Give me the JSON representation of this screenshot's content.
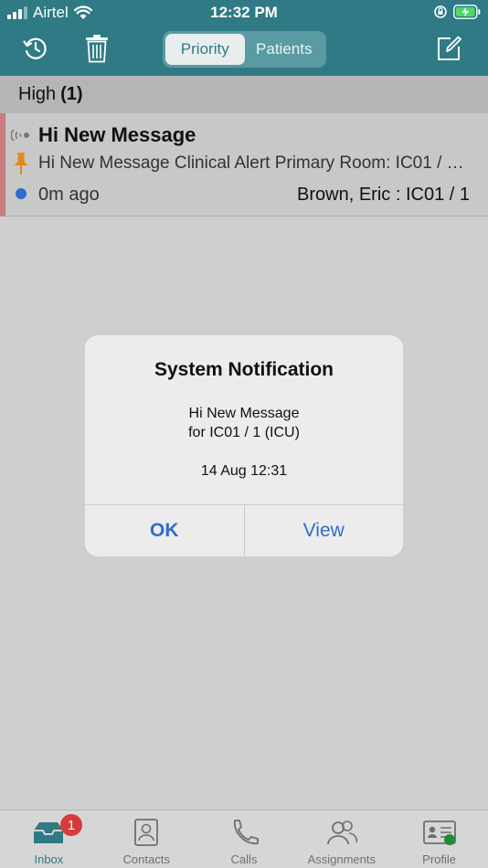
{
  "status_bar": {
    "carrier": "Airtel",
    "time": "12:32 PM"
  },
  "toolbar": {
    "segments": [
      {
        "label": "Priority",
        "active": true
      },
      {
        "label": "Patients",
        "active": false
      }
    ]
  },
  "section": {
    "label": "High",
    "count": "(1)"
  },
  "message": {
    "title": "Hi New Message",
    "body": "Hi New Message Clinical Alert Primary Room: IC01 / 1 (ICU)",
    "time": "0m ago",
    "patient": "Brown, Eric : IC01 / 1"
  },
  "dialog": {
    "title": "System Notification",
    "line1": "Hi New Message",
    "line2": "for IC01 / 1 (ICU)",
    "date": "14 Aug 12:31",
    "ok_label": "OK",
    "view_label": "View"
  },
  "tabbar": {
    "tabs": [
      {
        "label": "Inbox",
        "icon": "inbox-icon",
        "active": true,
        "badge": "1"
      },
      {
        "label": "Contacts",
        "icon": "contacts-icon"
      },
      {
        "label": "Calls",
        "icon": "phone-icon"
      },
      {
        "label": "Assignments",
        "icon": "assignments-icon"
      },
      {
        "label": "Profile",
        "icon": "profile-icon"
      }
    ]
  },
  "colors": {
    "header": "#2f7a84",
    "accent_blue": "#2f6bd0",
    "priority_stripe": "#c97d82",
    "badge": "#d63a3a",
    "online": "#1f8a3a"
  }
}
